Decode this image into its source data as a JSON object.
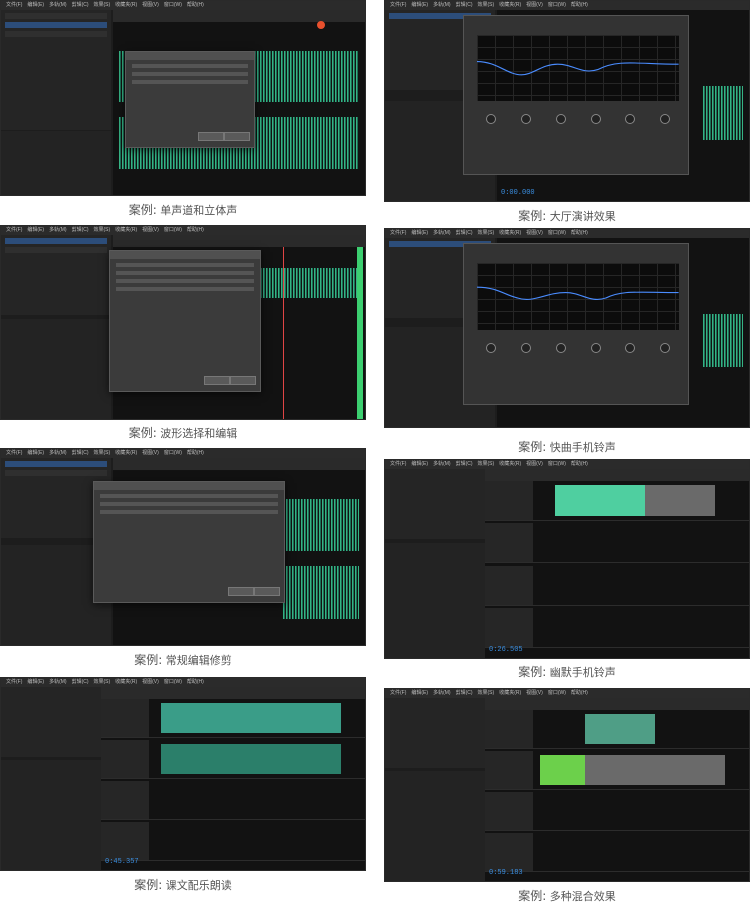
{
  "captions": [
    {
      "prefix": "案例:",
      "title": "单声道和立体声"
    },
    {
      "prefix": "案例:",
      "title": "大厅演讲效果"
    },
    {
      "prefix": "案例:",
      "title": "波形选择和编辑"
    },
    {
      "prefix": "案例:",
      "title": "快曲手机铃声"
    },
    {
      "prefix": "案例:",
      "title": "常规编辑修剪"
    },
    {
      "prefix": "案例:",
      "title": "幽默手机铃声"
    },
    {
      "prefix": "案例:",
      "title": "课文配乐朗读"
    },
    {
      "prefix": "案例:",
      "title": "多种混合效果"
    }
  ],
  "menu_items": [
    "文件(F)",
    "编辑(E)",
    "多轨(M)",
    "剪辑(C)",
    "效果(S)",
    "收藏夹(R)",
    "视图(V)",
    "窗口(W)",
    "帮助(H)"
  ],
  "timecodes": {
    "bal": "0:00.000",
    "funny": "0:26.505",
    "text": "0:45.357",
    "mix": "0:59.183"
  },
  "colors": {
    "waveform": "#3ccf98",
    "accent": "#2c4d7a",
    "playhead": "#e04545",
    "clip": "#3a9d88",
    "track_bar": "#3ccf70"
  }
}
